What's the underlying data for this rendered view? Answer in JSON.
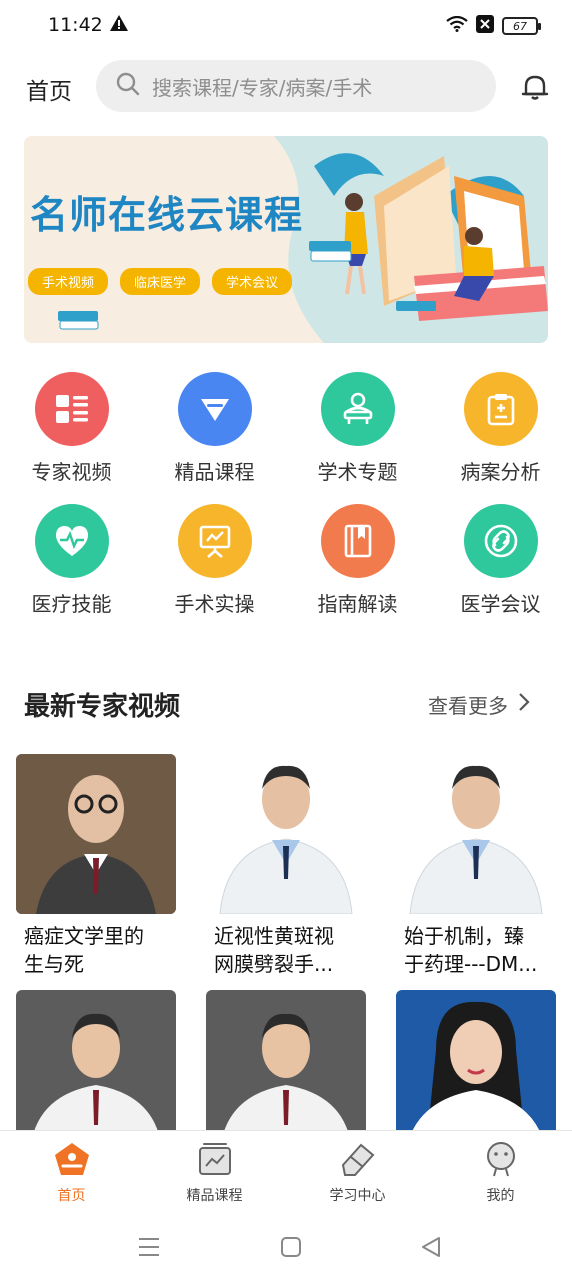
{
  "status_bar": {
    "time": "11:42",
    "battery": "67"
  },
  "header": {
    "title": "首页",
    "search_placeholder": "搜索课程/专家/病案/手术"
  },
  "banner": {
    "title": "名师在线云课程",
    "tags": [
      "手术视频",
      "临床医学",
      "学术会议"
    ]
  },
  "categories": [
    {
      "label": "专家视频",
      "icon": "list-icon",
      "color": "#f05f5f"
    },
    {
      "label": "精品课程",
      "icon": "diamond-icon",
      "color": "#4a86f2"
    },
    {
      "label": "学术专题",
      "icon": "lecturer-icon",
      "color": "#2fc79c"
    },
    {
      "label": "病案分析",
      "icon": "clipboard-icon",
      "color": "#f7b52c"
    },
    {
      "label": "医疗技能",
      "icon": "heart-icon",
      "color": "#2fc79c"
    },
    {
      "label": "手术实操",
      "icon": "presentation-icon",
      "color": "#f7b52c"
    },
    {
      "label": "指南解读",
      "icon": "book-icon",
      "color": "#f27b4e"
    },
    {
      "label": "医学会议",
      "icon": "link-icon",
      "color": "#2fc79c"
    }
  ],
  "section": {
    "title": "最新专家视频",
    "more": "查看更多"
  },
  "videos": [
    {
      "title_line1": "癌症文学里的",
      "title_line2": "生与死"
    },
    {
      "title_line1": "近视性黄斑视",
      "title_line2": "网膜劈裂手..."
    },
    {
      "title_line1": "始于机制，臻",
      "title_line2": "于药理---DM..."
    },
    {
      "title_line1": "",
      "title_line2": ""
    },
    {
      "title_line1": "",
      "title_line2": ""
    },
    {
      "title_line1": "",
      "title_line2": ""
    }
  ],
  "bottom_nav": [
    {
      "label": "首页",
      "active": true
    },
    {
      "label": "精品课程",
      "active": false
    },
    {
      "label": "学习中心",
      "active": false
    },
    {
      "label": "我的",
      "active": false
    }
  ],
  "colors": {
    "accent": "#f07224",
    "banner_title": "#1f86c4"
  }
}
